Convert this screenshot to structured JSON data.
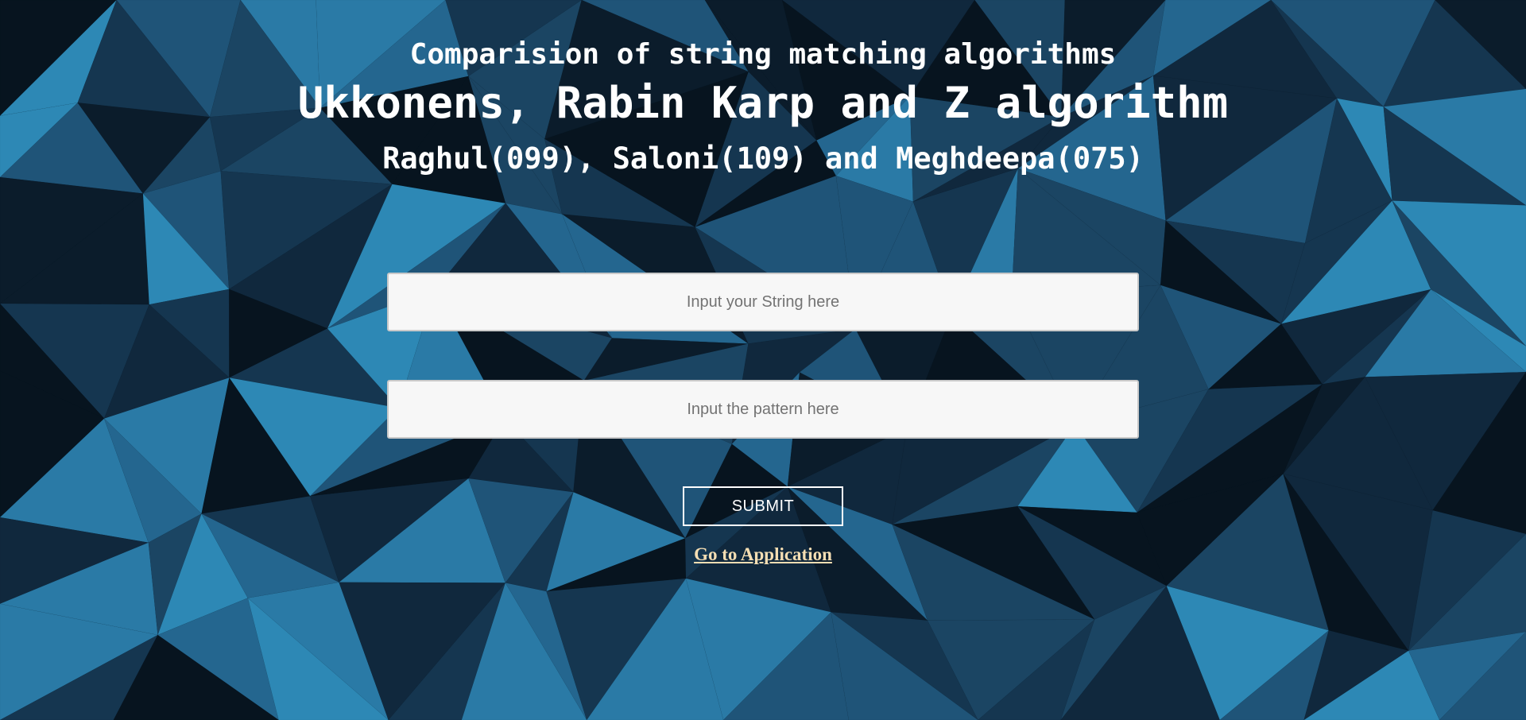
{
  "header": {
    "subtitle": "Comparision of string matching algorithms",
    "title": "Ukkonens, Rabin Karp and Z algorithm",
    "authors": "Raghul(099), Saloni(109) and Meghdeepa(075)"
  },
  "form": {
    "string_input": {
      "placeholder": "Input your String here",
      "value": ""
    },
    "pattern_input": {
      "placeholder": "Input the pattern here",
      "value": ""
    },
    "submit_label": "SUBMIT",
    "app_link_label": "Go to Application"
  },
  "colors": {
    "background_dark": "#0b1c2b",
    "background_mid": "#1d4f72",
    "background_light": "#2a82b0",
    "heading_text": "#ffffff",
    "link_text": "#f5deb3",
    "input_background": "#f7f7f7"
  }
}
